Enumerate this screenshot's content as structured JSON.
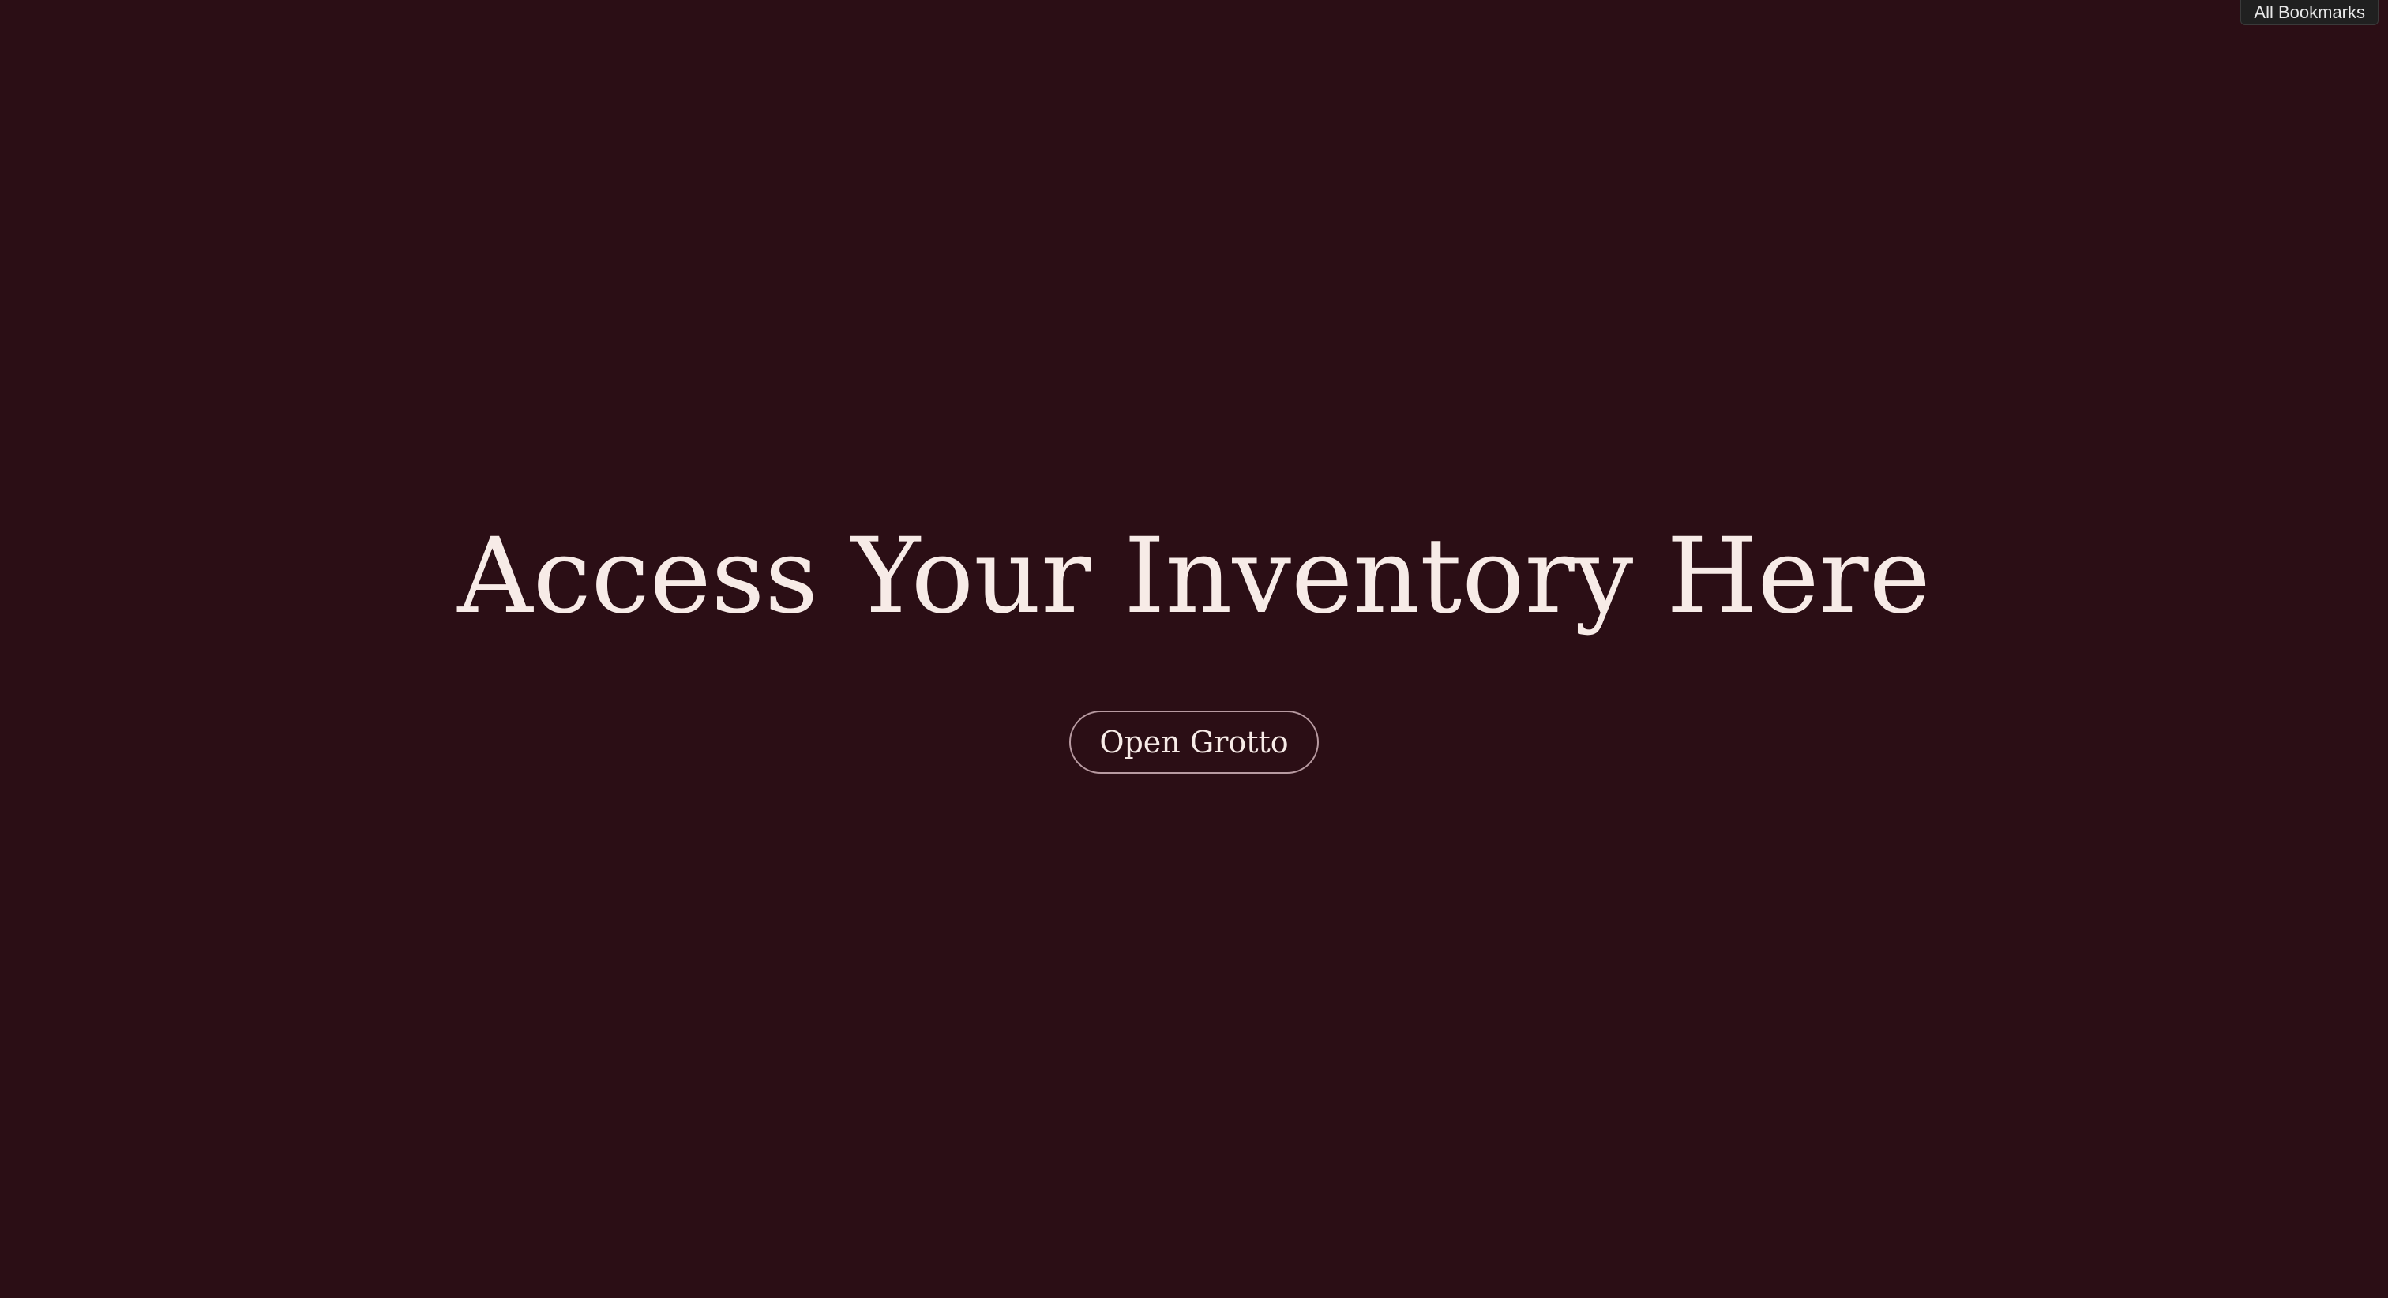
{
  "browser": {
    "bookmarks_label": "All Bookmarks"
  },
  "hero": {
    "title": "Access Your Inventory Here",
    "button_label": "Open Grotto"
  },
  "colors": {
    "background": "#2b0e15",
    "text": "#f7ebe7",
    "button_border": "#b89aa1"
  }
}
